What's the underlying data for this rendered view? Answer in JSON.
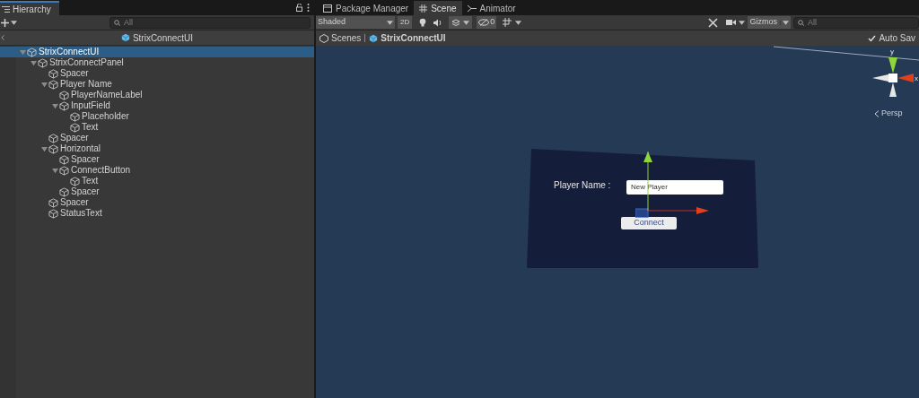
{
  "hierarchy": {
    "title": "Hierarchy",
    "search": {
      "placeholder": "All"
    },
    "scene_name": "StrixConnectUI",
    "tree": [
      {
        "label": "StrixConnectUI",
        "selected": true,
        "expanded": true,
        "children": [
          {
            "label": "StrixConnectPanel",
            "selected": false,
            "expanded": true,
            "children": [
              {
                "label": "Spacer",
                "selected": false
              },
              {
                "label": "Player Name",
                "selected": false,
                "expanded": true,
                "children": [
                  {
                    "label": "PlayerNameLabel",
                    "selected": false
                  },
                  {
                    "label": "InputField",
                    "selected": false,
                    "expanded": true,
                    "children": [
                      {
                        "label": "Placeholder",
                        "selected": false
                      },
                      {
                        "label": "Text",
                        "selected": false
                      }
                    ]
                  }
                ]
              },
              {
                "label": "Spacer",
                "selected": false
              },
              {
                "label": "Horizontal",
                "selected": false,
                "expanded": true,
                "children": [
                  {
                    "label": "Spacer",
                    "selected": false
                  },
                  {
                    "label": "ConnectButton",
                    "selected": false,
                    "expanded": true,
                    "children": [
                      {
                        "label": "Text",
                        "selected": false
                      }
                    ]
                  },
                  {
                    "label": "Spacer",
                    "selected": false
                  }
                ]
              },
              {
                "label": "Spacer",
                "selected": false
              },
              {
                "label": "StatusText",
                "selected": false
              }
            ]
          }
        ]
      }
    ]
  },
  "tabs": [
    {
      "label": "Package Manager",
      "kind": "package",
      "selected": false
    },
    {
      "label": "Scene",
      "kind": "grid",
      "selected": true
    },
    {
      "label": "Animator",
      "kind": "animator",
      "selected": false
    }
  ],
  "toolbar": {
    "shading": "Shaded",
    "mode_2d": "2D",
    "hidden_count": "0",
    "gizmos": "Gizmos",
    "search": {
      "placeholder": "All"
    }
  },
  "breadcrumbs": [
    {
      "label": "Scenes",
      "kind": "scenes"
    },
    {
      "label": "StrixConnectUI",
      "kind": "prefab"
    }
  ],
  "auto_save": {
    "label": "Auto Sav",
    "checked": true
  },
  "viewport": {
    "label_text": "Player Name :",
    "input_value": "New Player",
    "button_label": "Connect",
    "gizmo": {
      "y": "y",
      "x": "x",
      "persp": "Persp"
    }
  }
}
